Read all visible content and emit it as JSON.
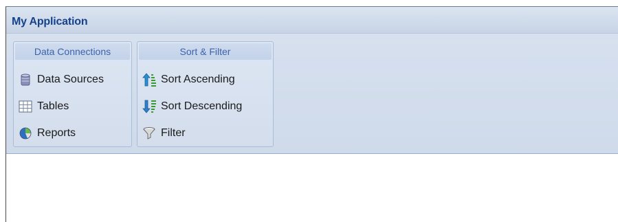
{
  "app": {
    "title": "My Application"
  },
  "ribbon": {
    "groups": [
      {
        "header": "Data Connections",
        "items": [
          {
            "label": "Data Sources",
            "icon": "database-icon"
          },
          {
            "label": "Tables",
            "icon": "table-grid-icon"
          },
          {
            "label": "Reports",
            "icon": "pie-chart-icon"
          }
        ]
      },
      {
        "header": "Sort & Filter",
        "items": [
          {
            "label": "Sort Ascending",
            "icon": "sort-ascending-icon"
          },
          {
            "label": "Sort Descending",
            "icon": "sort-descending-icon"
          },
          {
            "label": "Filter",
            "icon": "funnel-icon"
          }
        ]
      }
    ]
  },
  "colors": {
    "title_text": "#15428b",
    "group_header_text": "#3c63a8",
    "ribbon_background": "#d3ddec",
    "sort_arrow_up": "#2a8fd0",
    "sort_arrow_down": "#2f7fc8",
    "sort_bars": "#3a9a2e"
  }
}
